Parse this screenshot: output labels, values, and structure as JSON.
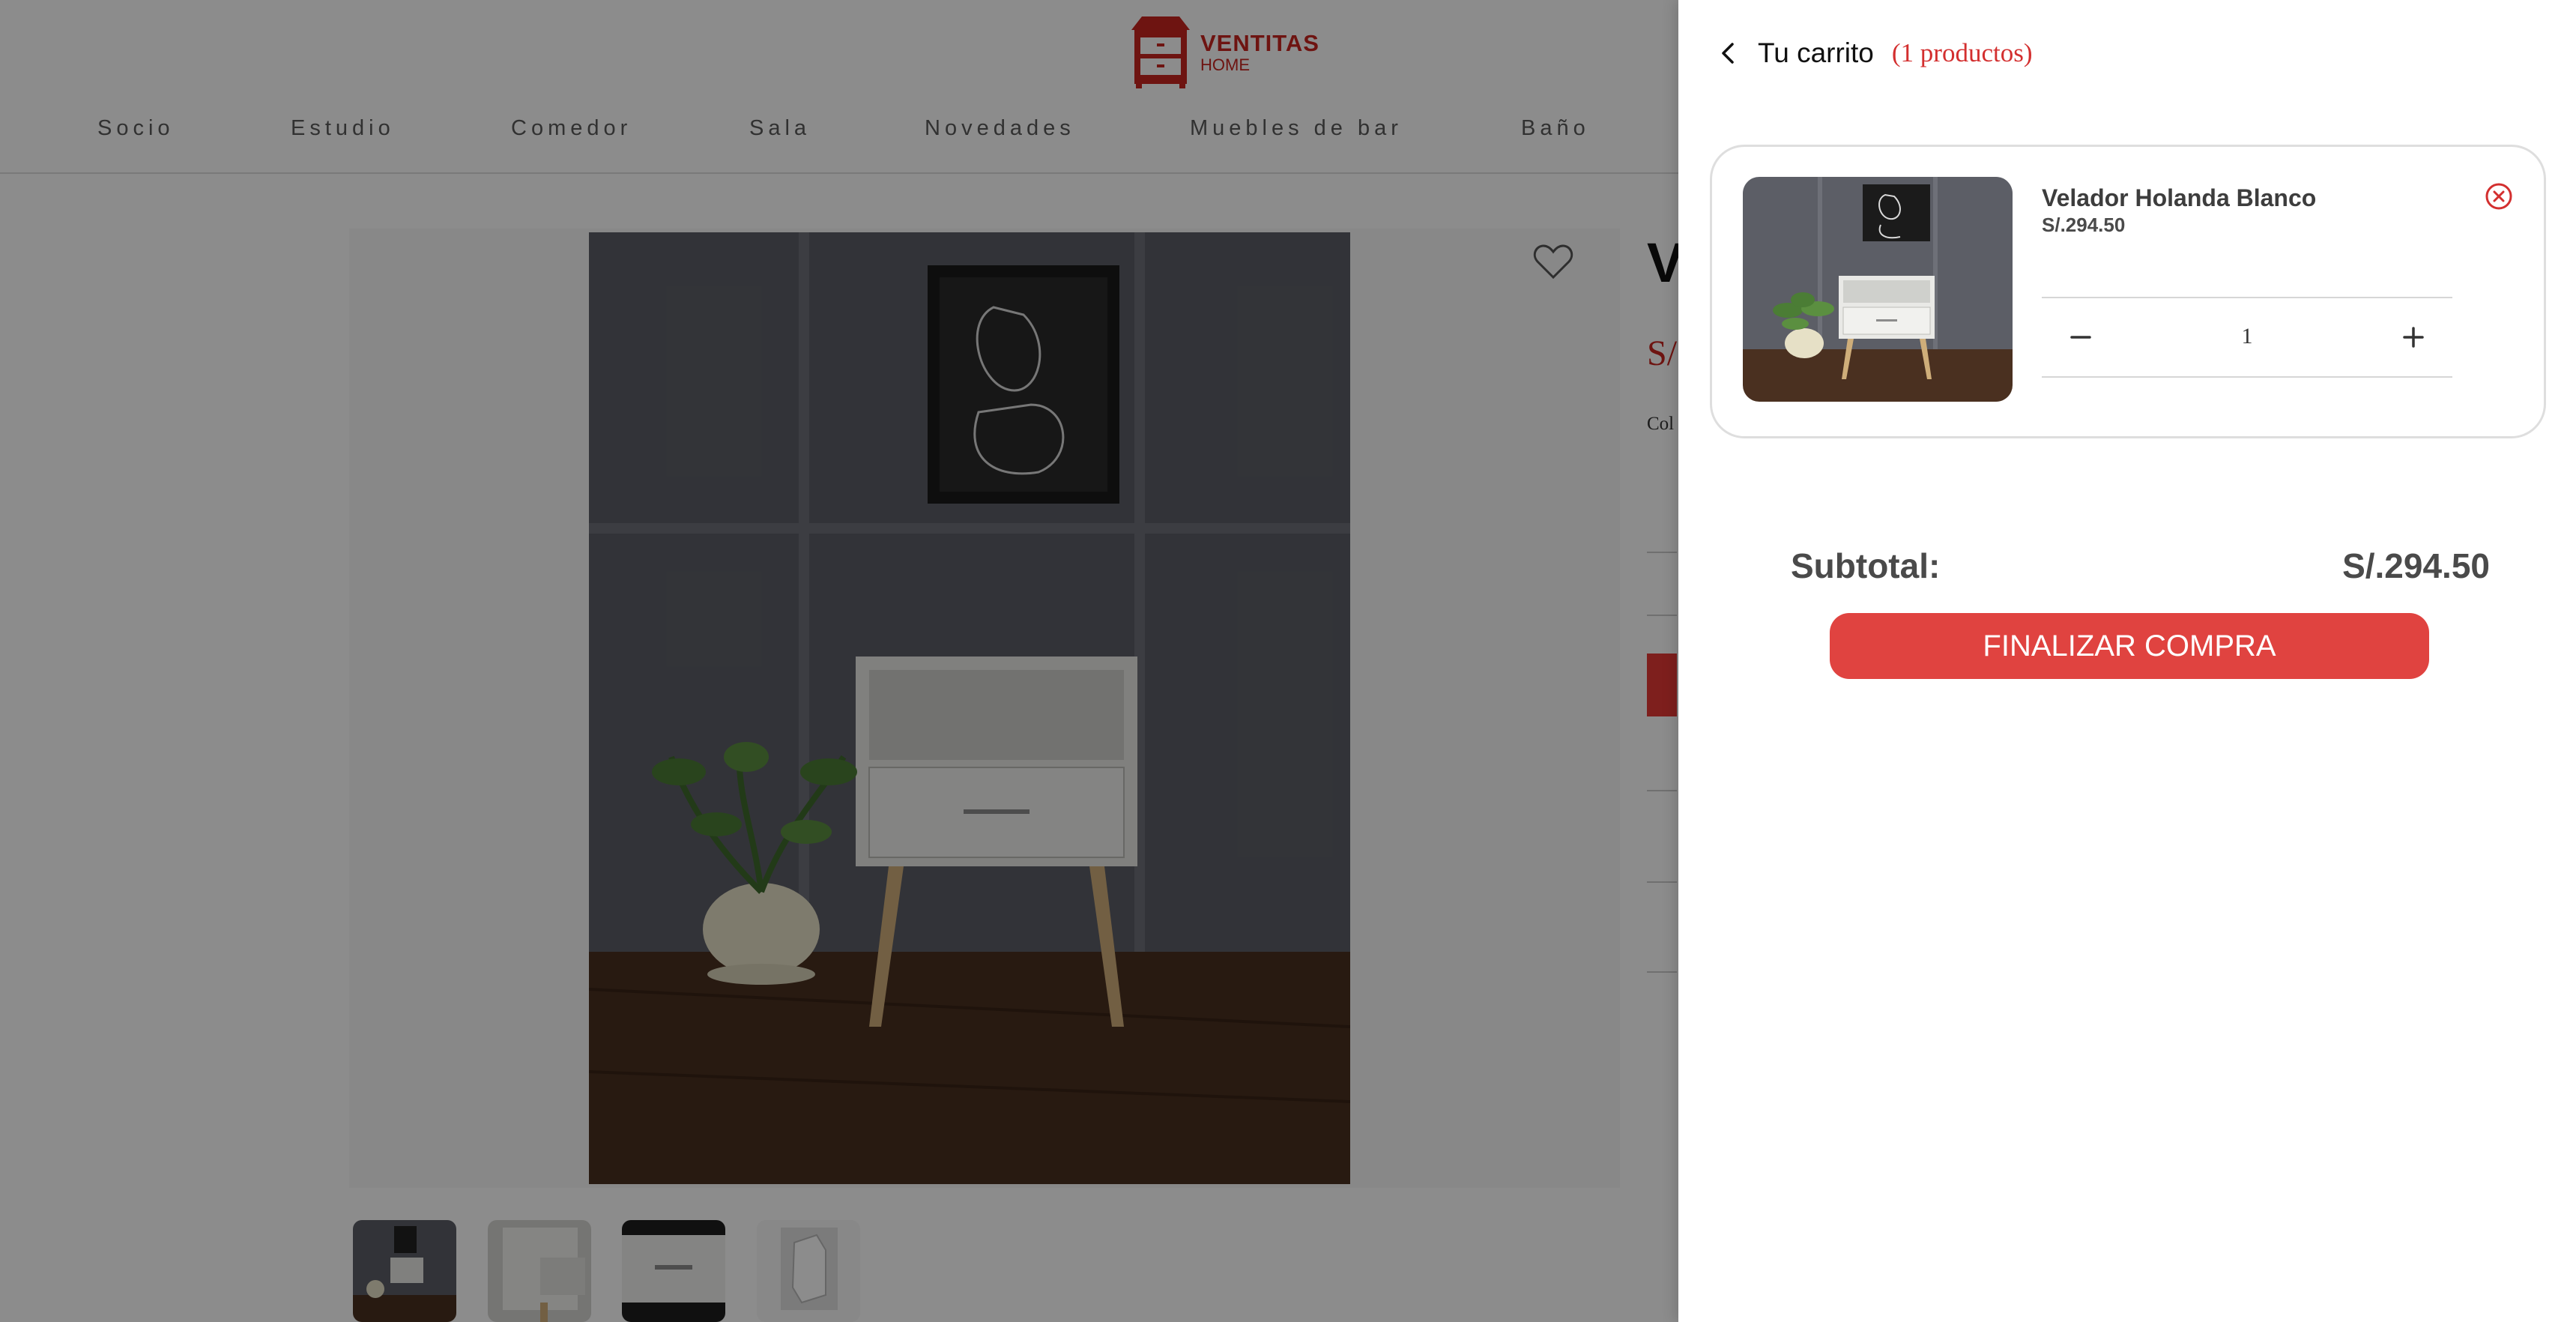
{
  "brand": {
    "name": "VENTITAS",
    "sub": "HOME",
    "accent": "#c8261f"
  },
  "nav": [
    "Socio",
    "Estudio",
    "Comedor",
    "Sala",
    "Novedades",
    "Muebles de bar",
    "Baño"
  ],
  "product_preview": {
    "title_partial": "V",
    "price_partial": "S/",
    "option_partial": "Col"
  },
  "cart": {
    "title": "Tu carrito",
    "count_label": "(1 productos)",
    "items": [
      {
        "name": "Velador Holanda Blanco",
        "price": "S/.294.50",
        "quantity": "1"
      }
    ],
    "subtotal_label": "Subtotal:",
    "subtotal_value": "S/.294.50",
    "checkout_label": "FINALIZAR COMPRA",
    "checkout_color": "#e04340"
  },
  "icons": [
    "back-chevron-icon",
    "remove-circle-x-icon",
    "minus-icon",
    "plus-icon",
    "heart-icon"
  ]
}
